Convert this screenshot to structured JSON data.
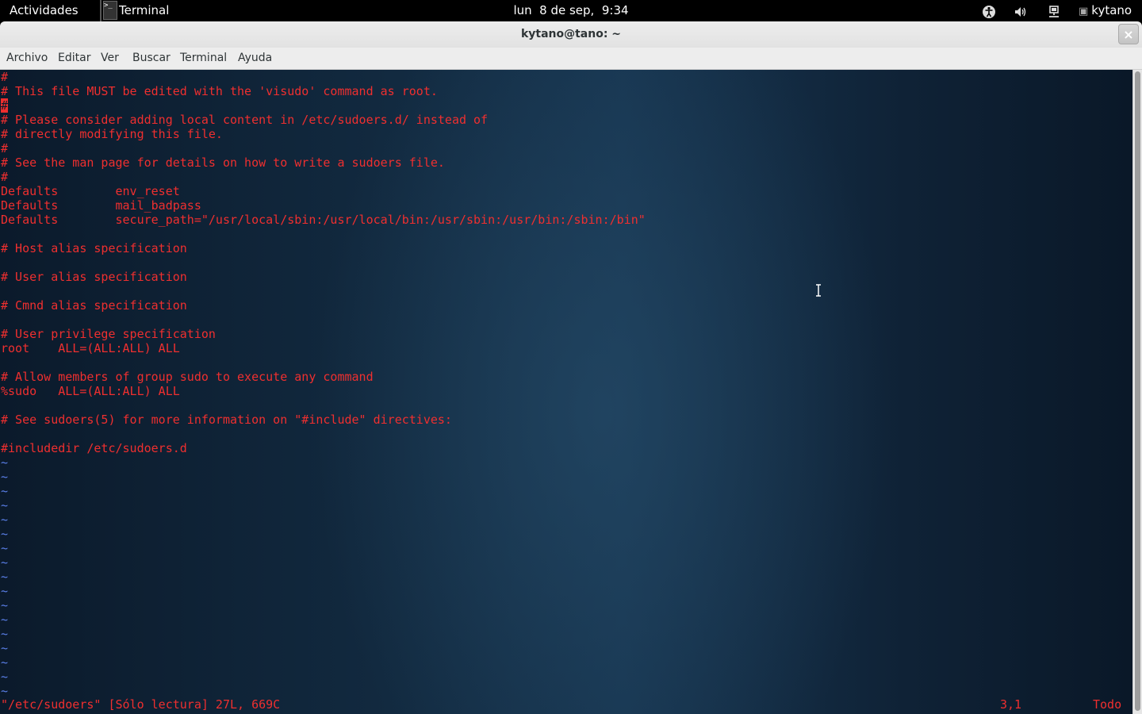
{
  "topbar": {
    "activities": "Actividades",
    "app_name": "Terminal",
    "app_icon_glyph": ">_",
    "clock": "lun  8 de sep,  9:34",
    "user": "kytano",
    "icons": [
      "accessibility-icon",
      "volume-icon",
      "network-icon",
      "user-icon"
    ]
  },
  "window": {
    "title": "kytano@tano: ~",
    "close_glyph": "×"
  },
  "menubar": {
    "archivo": "Archivo",
    "editar": "Editar",
    "ver": "Ver",
    "buscar": "Buscar",
    "terminal": "Terminal",
    "ayuda": "Ayuda"
  },
  "editor": {
    "lines": [
      "#",
      "# This file MUST be edited with the 'visudo' command as root.",
      "#",
      "# Please consider adding local content in /etc/sudoers.d/ instead of",
      "# directly modifying this file.",
      "#",
      "# See the man page for details on how to write a sudoers file.",
      "#",
      "Defaults        env_reset",
      "Defaults        mail_badpass",
      "Defaults        secure_path=\"/usr/local/sbin:/usr/local/bin:/usr/sbin:/usr/bin:/sbin:/bin\"",
      "",
      "# Host alias specification",
      "",
      "# User alias specification",
      "",
      "# Cmnd alias specification",
      "",
      "# User privilege specification",
      "root    ALL=(ALL:ALL) ALL",
      "",
      "# Allow members of group sudo to execute any command",
      "%sudo   ALL=(ALL:ALL) ALL",
      "",
      "# See sudoers(5) for more information on \"#include\" directives:",
      "",
      "#includedir /etc/sudoers.d"
    ],
    "tilde": "~",
    "tilde_count": 17,
    "status_file": "\"/etc/sudoers\" [Sólo lectura] 27L, 669C",
    "status_position": "3,1",
    "status_scroll": "Todo",
    "colors": {
      "text": "#ef2f2f",
      "tilde": "#5a7fe8",
      "background": "#122a40"
    }
  }
}
